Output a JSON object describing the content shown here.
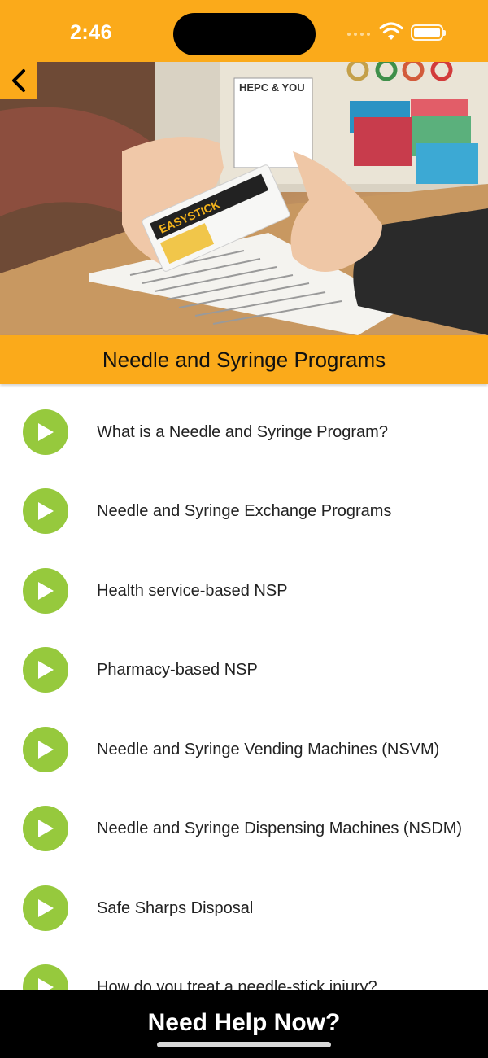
{
  "status_bar": {
    "time": "2:46",
    "background": "#FBAA1A"
  },
  "hero": {
    "image_description_icon": "pharmacy-photo",
    "sign_text": "HEPC & YOU",
    "pack_text": "EASYSTICK"
  },
  "nav": {
    "back_icon": "chevron-left-icon"
  },
  "page": {
    "title": "Needle and Syringe Programs"
  },
  "topics": {
    "items": [
      {
        "label": "What is a Needle and Syringe Program?"
      },
      {
        "label": "Needle and Syringe Exchange Programs"
      },
      {
        "label": "Health service-based NSP"
      },
      {
        "label": "Pharmacy-based NSP"
      },
      {
        "label": "Needle and Syringe Vending Machines (NSVM)"
      },
      {
        "label": "Needle and Syringe Dispensing Machines (NSDM)"
      },
      {
        "label": "Safe Sharps Disposal"
      },
      {
        "label": "How do you treat a needle-stick injury?"
      }
    ],
    "play_color": "#96C93D"
  },
  "footer": {
    "help_label": "Need Help Now?"
  }
}
